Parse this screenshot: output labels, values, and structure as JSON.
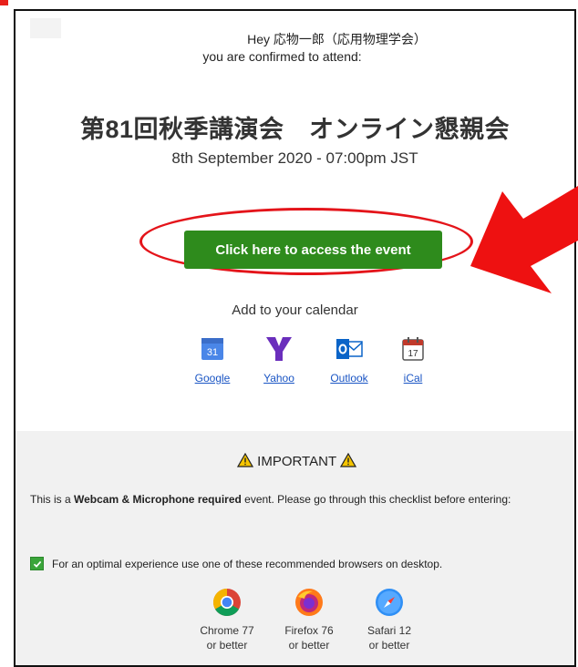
{
  "greeting": {
    "line1": "Hey 応物一郎（応用物理学会）",
    "line2": "you are confirmed to attend:"
  },
  "event": {
    "title": "第81回秋季講演会　オンライン懇親会",
    "date": "8th September 2020 - 07:00pm JST"
  },
  "cta": {
    "label": "Click here to access the event"
  },
  "calendar": {
    "title": "Add to your calendar",
    "google_day": "31",
    "ical_day": "17",
    "items": [
      {
        "label": "Google",
        "icon": "google-calendar-icon"
      },
      {
        "label": "Yahoo",
        "icon": "yahoo-icon"
      },
      {
        "label": "Outlook",
        "icon": "outlook-icon"
      },
      {
        "label": "iCal",
        "icon": "ical-icon"
      }
    ]
  },
  "important": {
    "title": "IMPORTANT",
    "body_prefix": "This is a ",
    "body_bold": "Webcam & Microphone required",
    "body_suffix": " event. Please go through this checklist before entering:",
    "checklist": "For an optimal experience use one of these recommended browsers on desktop.",
    "browsers": [
      {
        "name": "Chrome 77",
        "note": "or better",
        "icon": "chrome-icon"
      },
      {
        "name": "Firefox 76",
        "note": "or better",
        "icon": "firefox-icon"
      },
      {
        "name": "Safari 12",
        "note": "or better",
        "icon": "safari-icon"
      }
    ]
  },
  "colors": {
    "cta": "#2e8b1c",
    "annotation": "#e4141a",
    "link": "#1a55c4"
  }
}
